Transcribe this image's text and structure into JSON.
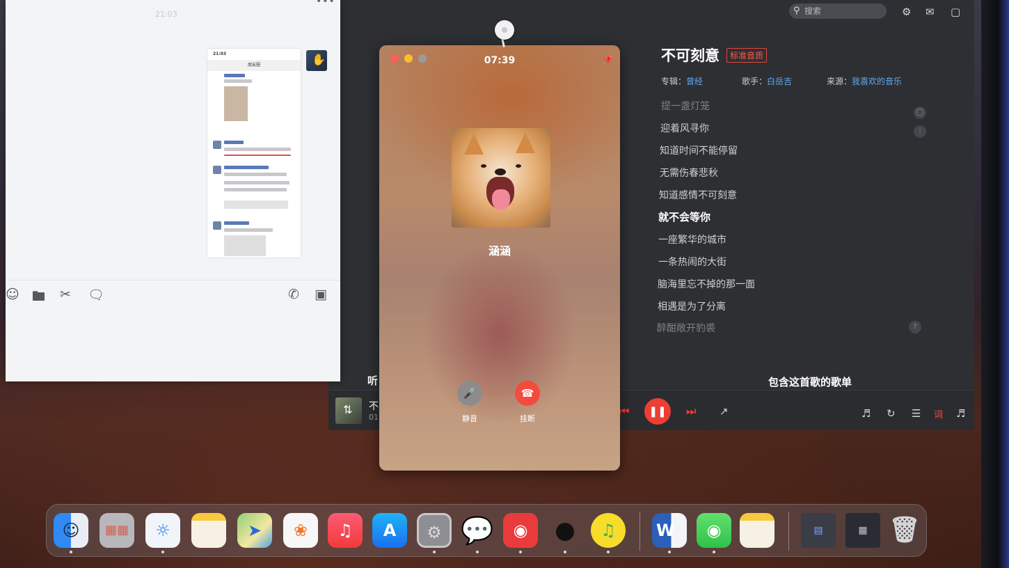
{
  "music": {
    "search_placeholder": "搜索",
    "song_title": "不可刻意",
    "quality": "标准音质",
    "album_label": "专辑：",
    "album": "曾经",
    "artist_label": "歌手：",
    "artist": "白岳吉",
    "source_label": "来源：",
    "source": "我喜欢的音乐",
    "lyrics": [
      "提一盏灯笼",
      "迎着风寻你",
      "知道时间不能停留",
      "无需伤春悲秋",
      "知道感情不可刻意",
      "就不会等你",
      "一座繁华的城市",
      "一条热闹的大街",
      "脑海里忘不掉的那一面",
      "相遇是为了分离",
      "醉酣敞开豹裘"
    ],
    "active_lyric_index": 5,
    "playlist_heading": "包含这首歌的歌单",
    "listen_tab": "听",
    "mini_song": "不",
    "mini_time": "01",
    "icons": {
      "search": "search-icon",
      "settings": "gear-icon",
      "mail": "mail-icon",
      "skin": "shirt-icon",
      "prev": "skip-back-icon",
      "pause": "pause-icon",
      "next": "skip-forward-icon",
      "share": "share-icon",
      "equalizer": "sound-effect-icon",
      "loop": "loop-icon",
      "playlist": "playlist-icon",
      "lyric": "lyric-icon",
      "volume": "volume-icon"
    },
    "lyric_glyph": "词",
    "accent_color": "#ec3e33"
  },
  "call": {
    "timer": "07:39",
    "caller": "涵涵",
    "mute_label": "静音",
    "hangup_label": "挂断",
    "colors": {
      "close": "#ff5f57",
      "minimize": "#febc2e",
      "zoom": "#9b9b9b",
      "hangup": "#f44b3f",
      "mute": "#8c8c8c"
    }
  },
  "wechat": {
    "clock": "21:03",
    "phone_status_time": "21:03",
    "phone_header": "朋友圈",
    "toolbar_icons": [
      "emoji-icon",
      "folder-icon",
      "scissors-icon",
      "chat-history-icon",
      "phone-icon",
      "video-icon"
    ]
  },
  "dock": {
    "apps": [
      "Finder",
      "Launchpad",
      "Safari",
      "Notes",
      "Maps",
      "Photos",
      "Music",
      "App Store",
      "System Settings",
      "WeChat",
      "NetEase Cloud Music",
      "QQ",
      "QQ Music",
      "Word",
      "Messages",
      "Notes",
      "Downloads",
      "Desktop",
      "Trash"
    ],
    "word_letter": "W"
  }
}
